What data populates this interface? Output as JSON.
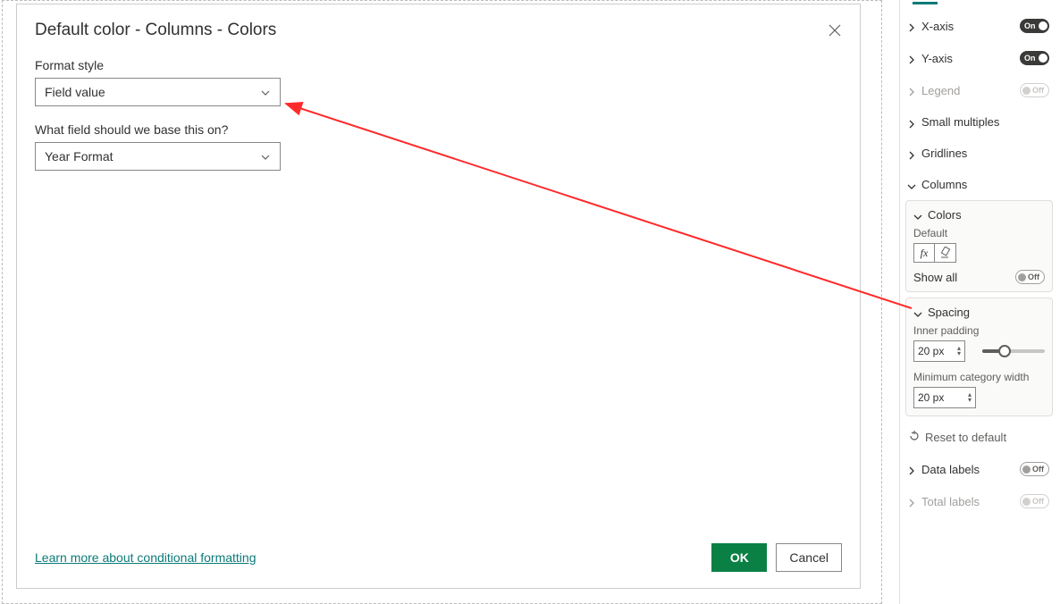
{
  "dialog": {
    "title": "Default color - Columns - Colors",
    "format_style_label": "Format style",
    "format_style_value": "Field value",
    "based_on_label": "What field should we base this on?",
    "based_on_value": "Year Format",
    "learn_more": "Learn more about conditional formatting",
    "ok": "OK",
    "cancel": "Cancel"
  },
  "pane": {
    "x_axis": "X-axis",
    "y_axis": "Y-axis",
    "legend": "Legend",
    "small_multiples": "Small multiples",
    "gridlines": "Gridlines",
    "columns": "Columns",
    "colors": "Colors",
    "default_label": "Default",
    "show_all": "Show all",
    "spacing": "Spacing",
    "inner_padding": "Inner padding",
    "inner_padding_value": "20 px",
    "min_cat_width": "Minimum category width",
    "min_cat_width_value": "20 px",
    "reset": "Reset to default",
    "data_labels": "Data labels",
    "total_labels": "Total labels",
    "toggle_on": "On",
    "toggle_off": "Off"
  }
}
